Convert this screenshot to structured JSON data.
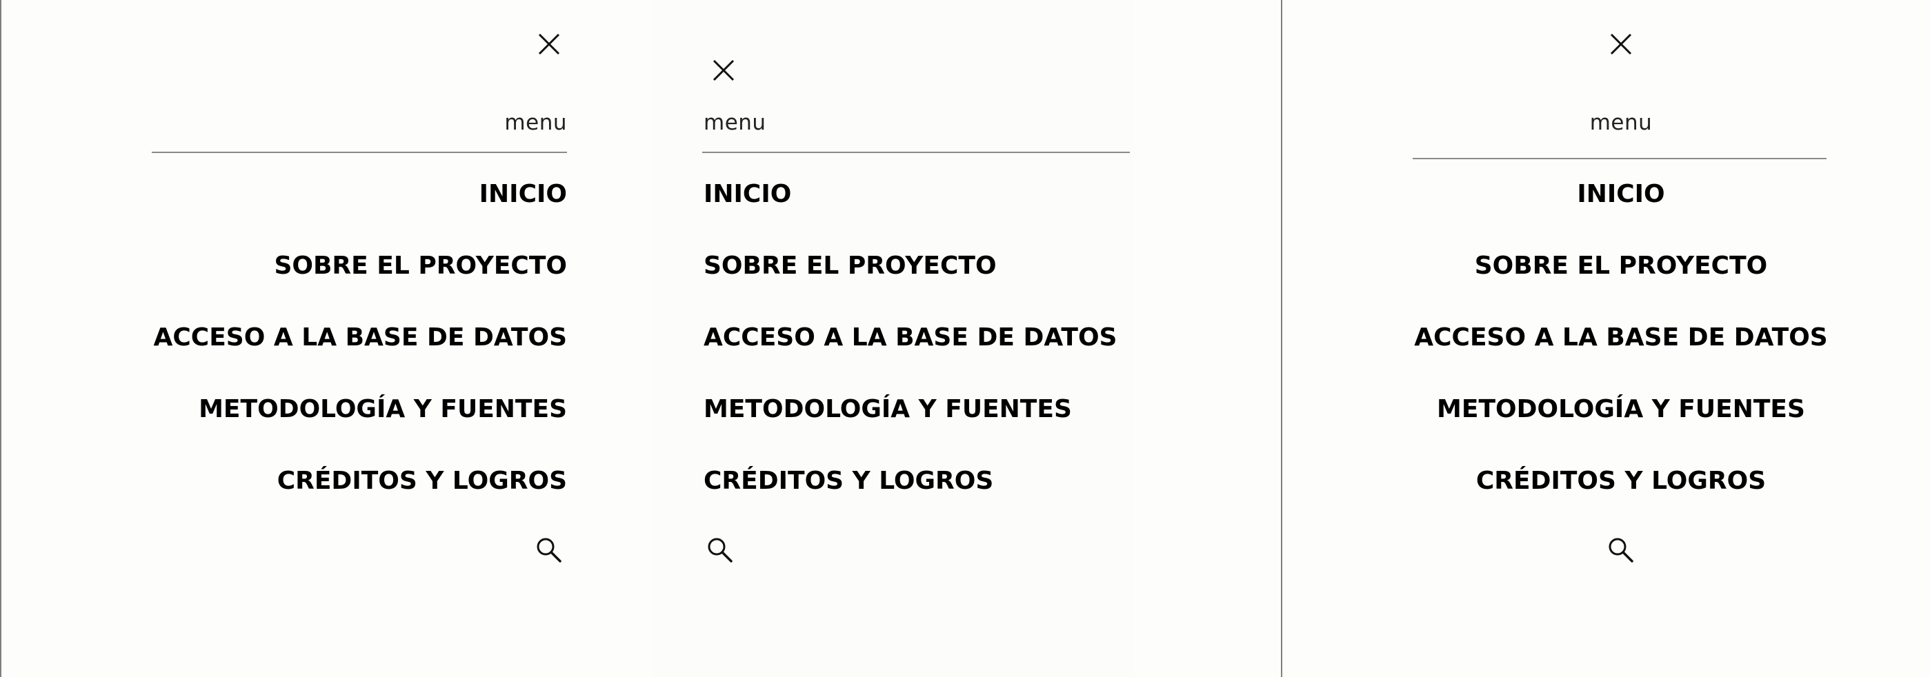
{
  "menu_label": "menu",
  "nav_items": [
    {
      "label": "INICIO"
    },
    {
      "label": "SOBRE EL PROYECTO"
    },
    {
      "label": "ACCESO A LA BASE DE DATOS"
    },
    {
      "label": "METODOLOGÍA Y FUENTES"
    },
    {
      "label": "CRÉDITOS Y LOGROS"
    }
  ],
  "icons": {
    "close": "close-icon",
    "search": "search-icon"
  },
  "colors": {
    "background": "#fdfdfc",
    "text": "#000000",
    "rule": "#8a8a8a",
    "frame_border": "#7f7f7f"
  }
}
